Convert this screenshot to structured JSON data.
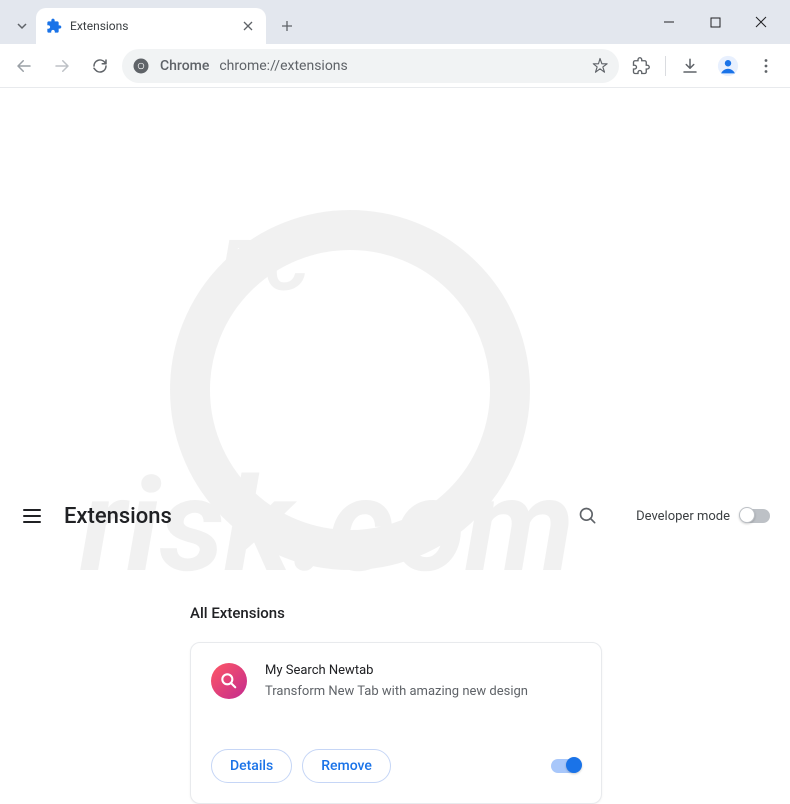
{
  "window": {
    "tab_title": "Extensions",
    "address_prefix": "Chrome",
    "address_url": "chrome://extensions"
  },
  "page": {
    "title": "Extensions",
    "developer_mode_label": "Developer mode",
    "section_title": "All Extensions"
  },
  "extension": {
    "name": "My Search Newtab",
    "description": "Transform New Tab with amazing new design",
    "details_label": "Details",
    "remove_label": "Remove",
    "enabled": true
  }
}
